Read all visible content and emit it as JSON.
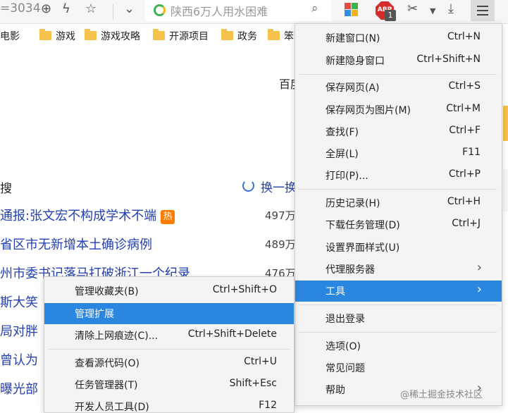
{
  "toolbar": {
    "url_fragment": "=3034",
    "zoom_icon": "zoom-in-icon",
    "lightning_icon": "lightning-icon",
    "star_icon": "star-icon",
    "dropdown_icon": "chevron-down-icon",
    "search_placeholder": "陕西6万人用水困难",
    "search_icon": "search-icon",
    "abp_label": "ABP",
    "abp_badge": "1",
    "scissors_icon": "scissors-icon",
    "download_icon": "download-icon",
    "menu_icon": "hamburger-menu-icon"
  },
  "bookmarks": [
    "电影",
    "游戏",
    "游戏攻略",
    "开源项目",
    "政务",
    "笨"
  ],
  "page": {
    "header_fragment": "百度",
    "section_fragment": "搜",
    "refresh_label": "换一换",
    "news": [
      {
        "title": "通报:张文宏不构成学术不端",
        "count": "497万",
        "hot": "热"
      },
      {
        "title": "省区市无新增本土确诊病例",
        "count": "489万"
      },
      {
        "title": "州市委书记落马打破浙江一个纪录",
        "count": "476万"
      },
      {
        "title": "斯大笑",
        "count": ""
      },
      {
        "title": "局对胖",
        "count": ""
      },
      {
        "title": "曾认为",
        "count": ""
      },
      {
        "title": "曝光部",
        "count": ""
      },
      {
        "title": "",
        "count": ""
      }
    ]
  },
  "main_menu": {
    "items": [
      {
        "label": "新建窗口(N)",
        "shortcut": "Ctrl+N"
      },
      {
        "label": "新建隐身窗口",
        "shortcut": "Ctrl+Shift+N"
      },
      {
        "label": "保存网页(A)",
        "shortcut": "Ctrl+S"
      },
      {
        "label": "保存网页为图片(M)",
        "shortcut": "Ctrl+M"
      },
      {
        "label": "查找(F)",
        "shortcut": "Ctrl+F"
      },
      {
        "label": "全屏(L)",
        "shortcut": "F11"
      },
      {
        "label": "打印(P)...",
        "shortcut": "Ctrl+P"
      },
      {
        "label": "历史记录(H)",
        "shortcut": "Ctrl+H"
      },
      {
        "label": "下载任务管理(D)",
        "shortcut": "Ctrl+J"
      },
      {
        "label": "设置界面样式(U)",
        "shortcut": ""
      },
      {
        "label": "代理服务器",
        "shortcut": ""
      },
      {
        "label": "工具",
        "shortcut": ""
      },
      {
        "label": "退出登录",
        "shortcut": ""
      },
      {
        "label": "选项(O)",
        "shortcut": ""
      },
      {
        "label": "常见问题",
        "shortcut": ""
      },
      {
        "label": "帮助",
        "shortcut": ""
      }
    ]
  },
  "tools_submenu": {
    "items": [
      {
        "label": "管理收藏夹(B)",
        "shortcut": "Ctrl+Shift+O"
      },
      {
        "label": "管理扩展",
        "shortcut": ""
      },
      {
        "label": "清除上网痕迹(C)...",
        "shortcut": "Ctrl+Shift+Delete"
      },
      {
        "label": "查看源代码(O)",
        "shortcut": "Ctrl+U"
      },
      {
        "label": "任务管理器(T)",
        "shortcut": "Shift+Esc"
      },
      {
        "label": "开发人员工具(D)",
        "shortcut": "F12"
      }
    ]
  },
  "watermark": "@稀土掘金技术社区",
  "colors": {
    "highlight": "#2b86e0",
    "link": "#2440b3",
    "folder": "#f5c34b",
    "hot_badge": "#ff7b00",
    "abp": "#d72a2a"
  }
}
